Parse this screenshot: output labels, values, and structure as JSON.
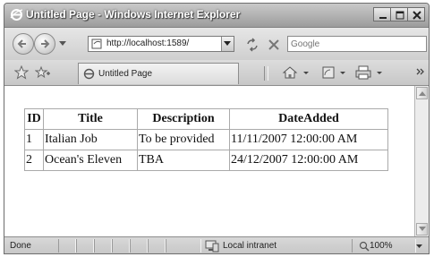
{
  "window": {
    "title": "Untitled Page - Windows Internet Explorer"
  },
  "address": {
    "url": "http://localhost:1589/"
  },
  "search": {
    "placeholder": "Google"
  },
  "tab": {
    "label": "Untitled Page"
  },
  "table": {
    "headers": [
      "ID",
      "Title",
      "Description",
      "DateAdded"
    ],
    "rows": [
      [
        "1",
        "Italian Job",
        "To be provided",
        "11/11/2007 12:00:00 AM"
      ],
      [
        "2",
        "Ocean's Eleven",
        "TBA",
        "24/12/2007 12:00:00 AM"
      ]
    ]
  },
  "status": {
    "text": "Done",
    "zone": "Local intranet",
    "zoom": "100%"
  }
}
